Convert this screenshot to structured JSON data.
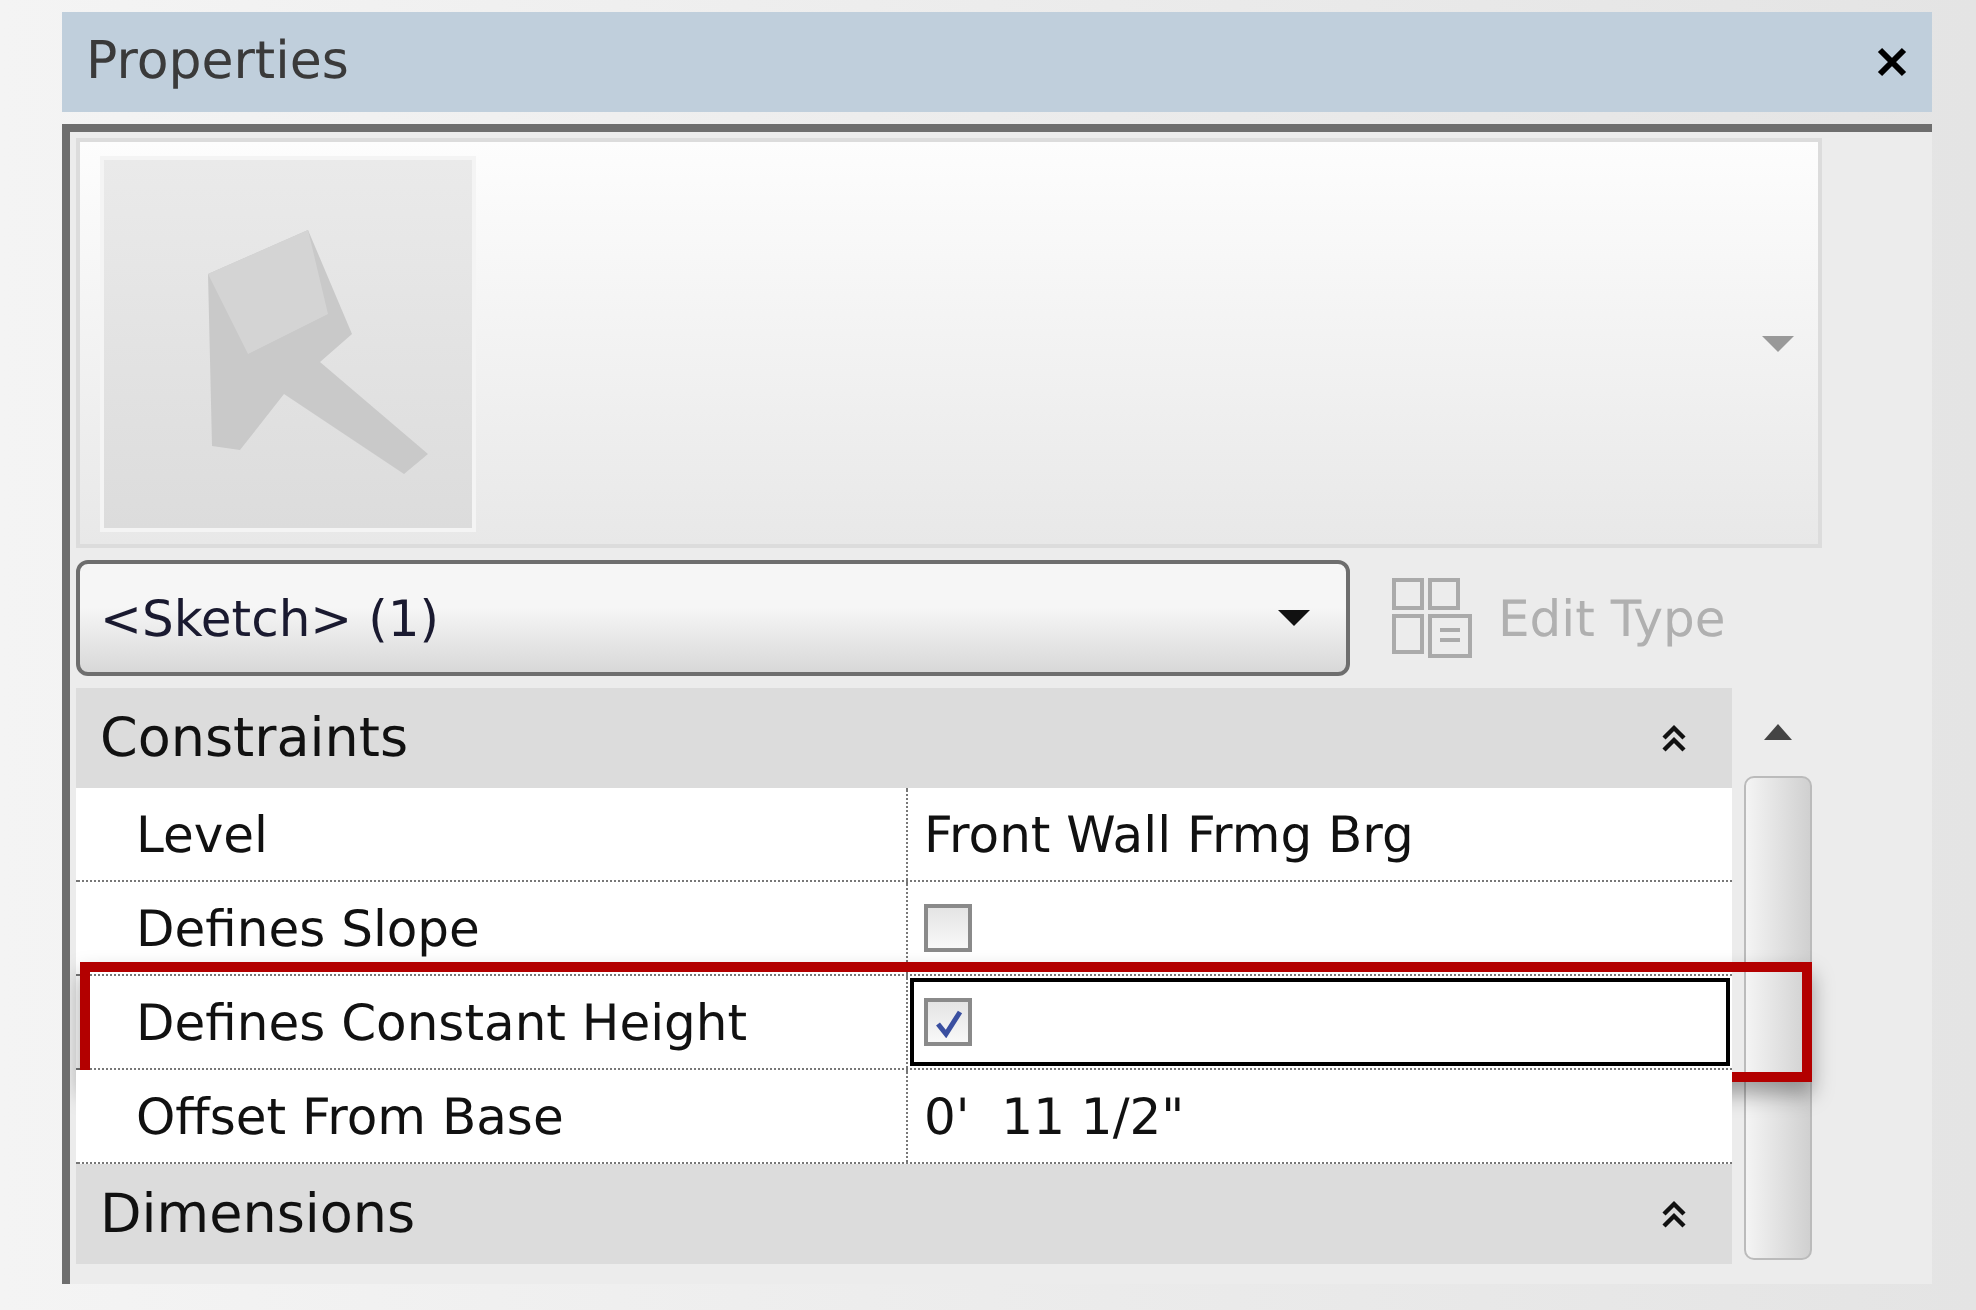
{
  "panel": {
    "title": "Properties"
  },
  "type_selector": {
    "value": "<Sketch> (1)"
  },
  "edit_type": {
    "label": "Edit Type",
    "disabled": true
  },
  "categories": [
    {
      "name": "Constraints",
      "expanded": true,
      "properties": [
        {
          "name": "Level",
          "kind": "text",
          "value": "Front Wall Frmg Brg",
          "selected": false
        },
        {
          "name": "Defines Slope",
          "kind": "checkbox",
          "checked": false,
          "selected": false
        },
        {
          "name": "Defines Constant Height",
          "kind": "checkbox",
          "checked": true,
          "selected": true
        },
        {
          "name": "Offset From Base",
          "kind": "text",
          "value": "0'  11 1/2\"",
          "selected": false
        }
      ]
    },
    {
      "name": "Dimensions",
      "expanded": true
    }
  ]
}
